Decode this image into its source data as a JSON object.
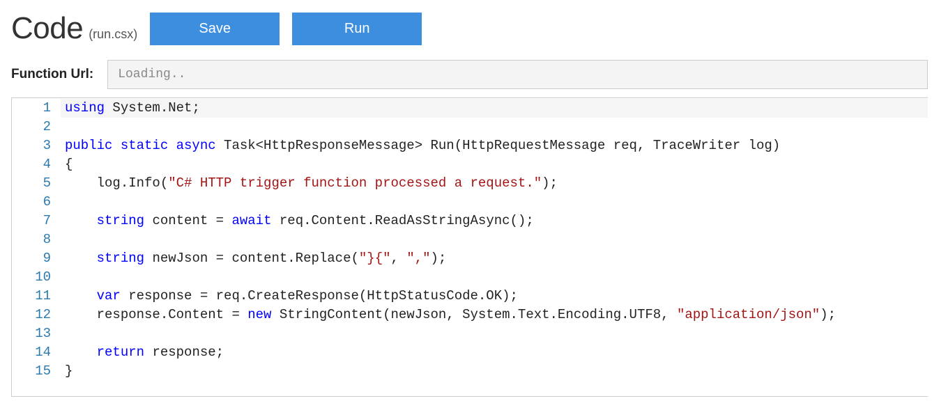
{
  "header": {
    "title": "Code",
    "subtitle": "(run.csx)",
    "save_label": "Save",
    "run_label": "Run"
  },
  "url": {
    "label": "Function Url:",
    "value": "Loading.."
  },
  "editor": {
    "lines": [
      {
        "n": 1,
        "active": true,
        "tokens": [
          {
            "t": "using ",
            "c": "kw"
          },
          {
            "t": "System.Net;",
            "c": "plain"
          }
        ]
      },
      {
        "n": 2,
        "tokens": []
      },
      {
        "n": 3,
        "tokens": [
          {
            "t": "public static async ",
            "c": "kw"
          },
          {
            "t": "Task<HttpResponseMessage> Run(HttpRequestMessage req, TraceWriter log)",
            "c": "plain"
          }
        ]
      },
      {
        "n": 4,
        "tokens": [
          {
            "t": "{",
            "c": "plain"
          }
        ]
      },
      {
        "n": 5,
        "tokens": [
          {
            "t": "    log.Info(",
            "c": "plain"
          },
          {
            "t": "\"C# HTTP trigger function processed a request.\"",
            "c": "str"
          },
          {
            "t": ");",
            "c": "plain"
          }
        ]
      },
      {
        "n": 6,
        "tokens": []
      },
      {
        "n": 7,
        "tokens": [
          {
            "t": "    ",
            "c": "plain"
          },
          {
            "t": "string ",
            "c": "kw"
          },
          {
            "t": "content = ",
            "c": "plain"
          },
          {
            "t": "await ",
            "c": "kw"
          },
          {
            "t": "req.Content.ReadAsStringAsync();",
            "c": "plain"
          }
        ]
      },
      {
        "n": 8,
        "tokens": []
      },
      {
        "n": 9,
        "tokens": [
          {
            "t": "    ",
            "c": "plain"
          },
          {
            "t": "string ",
            "c": "kw"
          },
          {
            "t": "newJson = content.Replace(",
            "c": "plain"
          },
          {
            "t": "\"}{\"",
            "c": "str"
          },
          {
            "t": ", ",
            "c": "plain"
          },
          {
            "t": "\",\"",
            "c": "str"
          },
          {
            "t": ");",
            "c": "plain"
          }
        ]
      },
      {
        "n": 10,
        "tokens": []
      },
      {
        "n": 11,
        "tokens": [
          {
            "t": "    ",
            "c": "plain"
          },
          {
            "t": "var ",
            "c": "kw"
          },
          {
            "t": "response = req.CreateResponse(HttpStatusCode.OK);",
            "c": "plain"
          }
        ]
      },
      {
        "n": 12,
        "tokens": [
          {
            "t": "    response.Content = ",
            "c": "plain"
          },
          {
            "t": "new ",
            "c": "kw"
          },
          {
            "t": "StringContent(newJson, System.Text.Encoding.UTF8, ",
            "c": "plain"
          },
          {
            "t": "\"application/json\"",
            "c": "str"
          },
          {
            "t": ");",
            "c": "plain"
          }
        ]
      },
      {
        "n": 13,
        "tokens": []
      },
      {
        "n": 14,
        "tokens": [
          {
            "t": "    ",
            "c": "plain"
          },
          {
            "t": "return ",
            "c": "kw"
          },
          {
            "t": "response;",
            "c": "plain"
          }
        ]
      },
      {
        "n": 15,
        "tokens": [
          {
            "t": "}",
            "c": "plain"
          }
        ]
      }
    ]
  }
}
